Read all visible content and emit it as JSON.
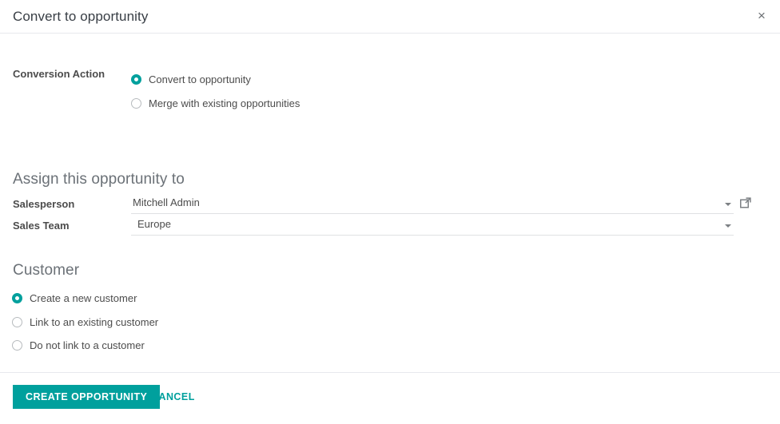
{
  "dialog": {
    "title": "Convert to opportunity",
    "close_icon": "close-icon",
    "close_label": "×"
  },
  "conversion": {
    "label": "Conversion Action",
    "options": [
      {
        "label": "Convert to opportunity",
        "selected": true
      },
      {
        "label": "Merge with existing opportunities",
        "selected": false
      }
    ]
  },
  "assign": {
    "heading": "Assign this opportunity to",
    "fields": [
      {
        "label": "Salesperson",
        "value": "Mitchell Admin",
        "caret_icon": "chevron-down-icon",
        "external_icon": "external-link-icon"
      },
      {
        "label": "Sales Team",
        "value": "Europe",
        "caret_icon": "chevron-down-icon"
      }
    ]
  },
  "customer": {
    "heading": "Customer",
    "options": [
      {
        "label": "Create a new customer",
        "selected": true
      },
      {
        "label": "Link to an existing customer",
        "selected": false
      },
      {
        "label": "Do not link to a customer",
        "selected": false
      }
    ]
  },
  "footer": {
    "create_label": "CREATE OPPORTUNITY",
    "cancel_label": "CANCEL"
  },
  "colors": {
    "accent": "#00a09d",
    "text": "#4c4c4c",
    "heading": "#6b7177",
    "border": "#e7e9ed"
  }
}
